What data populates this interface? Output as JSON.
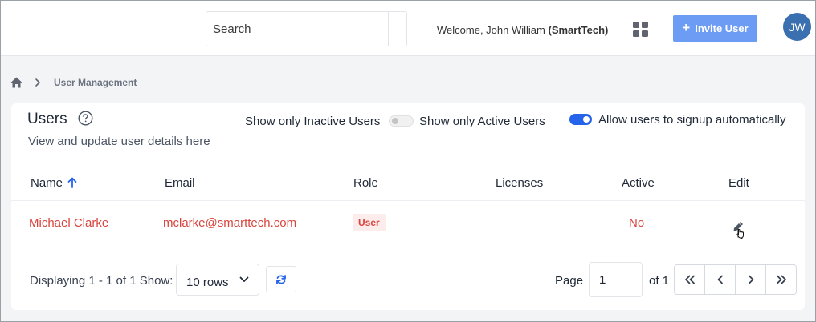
{
  "header": {
    "search_placeholder": "Search",
    "welcome_prefix": "Welcome, John William",
    "company": "(SmartTech)",
    "invite_label": "Invite User",
    "avatar_initials": "JW",
    "accent_color": "#6d9cf4"
  },
  "breadcrumb": {
    "icon": "home-icon",
    "current": "User Management"
  },
  "users_card": {
    "title": "Users",
    "subtitle": "View and update user details here",
    "filters": {
      "inactive_label": "Show only Inactive Users",
      "active_label": "Show only Active Users",
      "active_only_enabled": false,
      "signup_label": "Allow users to signup automatically",
      "signup_enabled": true
    },
    "columns": [
      "Name",
      "Email",
      "Role",
      "Licenses",
      "Active",
      "Edit"
    ],
    "sort": {
      "column": "Name",
      "direction": "ascending"
    },
    "rows": [
      {
        "name": "Michael Clarke",
        "email": "mclarke@smarttech.com",
        "role": "User",
        "licenses": "",
        "active": "No"
      }
    ]
  },
  "footer": {
    "displaying": "Displaying 1 - 1 of 1",
    "show_label": "Show:",
    "rows_option": "10 rows",
    "page_label": "Page",
    "page_value": "1",
    "of_label": "of 1"
  }
}
